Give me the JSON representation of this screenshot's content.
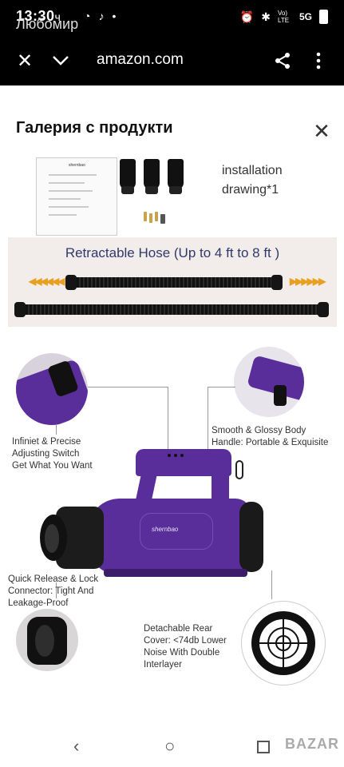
{
  "status_bar": {
    "time": "13:30",
    "carrier_overlay": "Любомир",
    "network": "5G",
    "lte": "Vo) LTE",
    "time_suffix": "ч"
  },
  "browser": {
    "url": "amazon.com",
    "close_icon": "close-icon",
    "collapse_icon": "chevron-down-icon",
    "share_icon": "share-icon",
    "menu_icon": "more-vert-icon"
  },
  "gallery": {
    "title": "Галерия с продукти",
    "close_label": "✕",
    "panel1": {
      "text_line1": "installation",
      "text_line2": "drawing*1",
      "manual_brand": "shernbao"
    },
    "panel2": {
      "title": "Retractable Hose (Up to 4 ft to 8 ft )",
      "left_arrows": "◀◀◀◀◀◀",
      "right_arrows": "▶▶▶▶▶▶"
    },
    "panel3": {
      "label_switch": [
        "Infiniet & Precise",
        "Adjusting Switch",
        "Get What You Want"
      ],
      "label_handle": [
        "Smooth & Glossy Body",
        "Handle: Portable & Exquisite"
      ],
      "label_connector": [
        "Quick Release & Lock",
        "Connector: Tight And",
        "Leakage-Proof"
      ],
      "label_cover": [
        "Detachable Rear",
        "Cover: <74db Lower",
        "Noise With Double",
        "Interlayer"
      ],
      "brand": "shernbao",
      "accent_color": "#5a2e9a"
    }
  },
  "navbar": {
    "back": "‹",
    "home": "○",
    "watermark": "BAZAR"
  }
}
